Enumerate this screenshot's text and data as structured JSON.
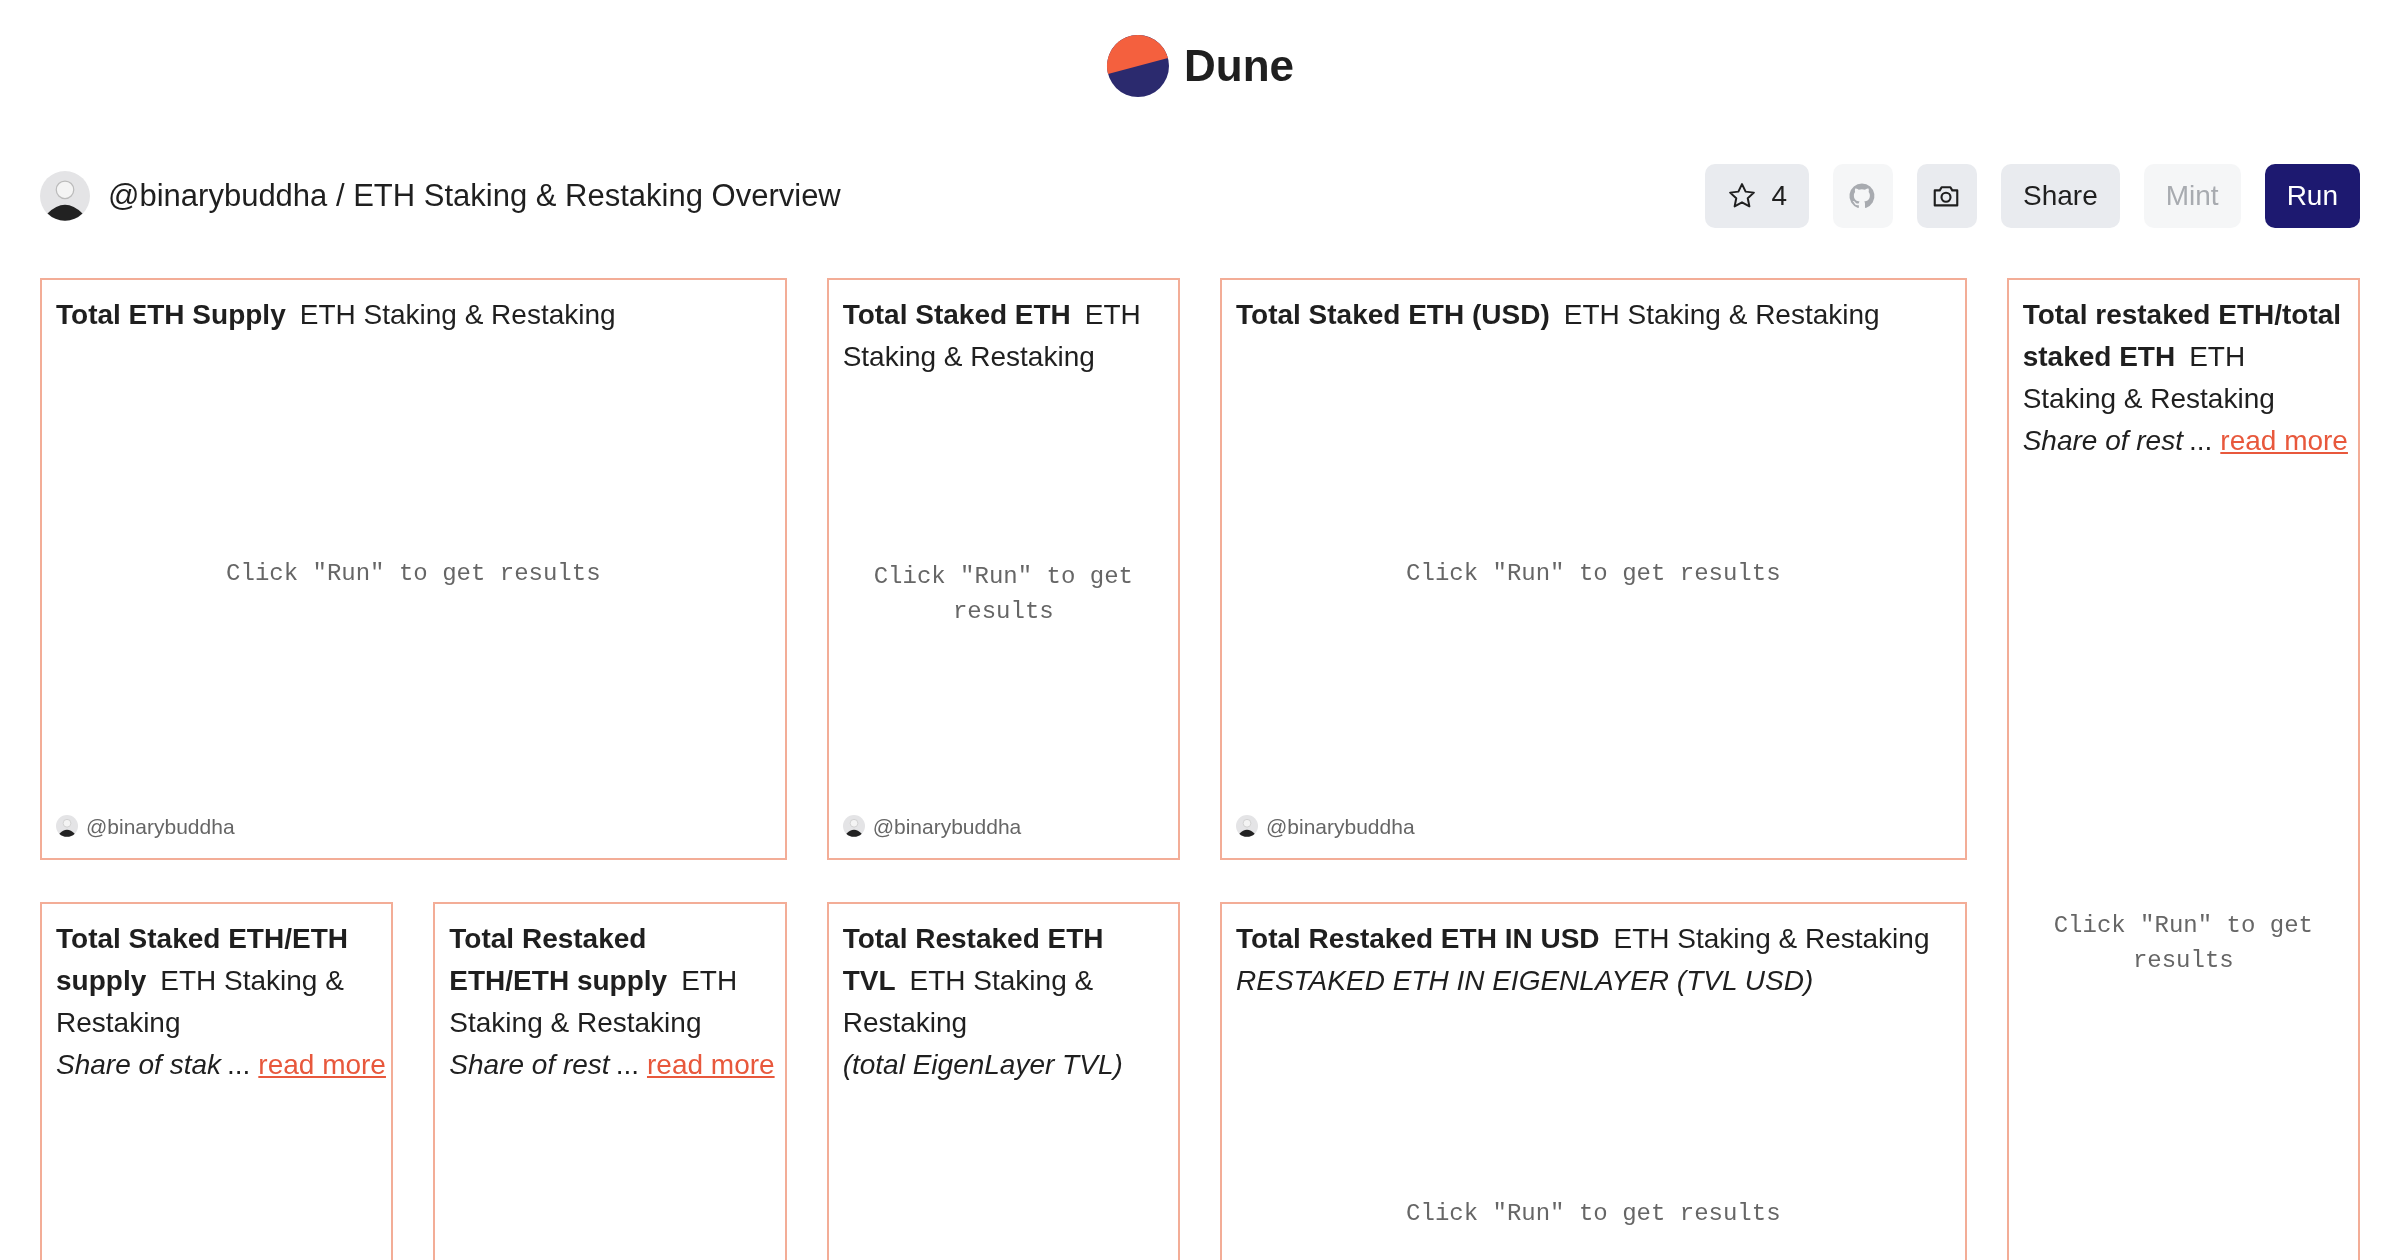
{
  "logo": {
    "text": "Dune"
  },
  "header": {
    "title": "@binarybuddha / ETH Staking & Restaking Overview"
  },
  "toolbar": [
    {
      "kind": "star",
      "label": "4",
      "disabled": false
    },
    {
      "kind": "github",
      "disabled": true
    },
    {
      "kind": "camera",
      "disabled": false
    },
    {
      "kind": "text",
      "label": "Share",
      "disabled": false
    },
    {
      "kind": "text",
      "label": "Mint",
      "disabled": true
    },
    {
      "kind": "primary",
      "label": "Run",
      "disabled": false
    }
  ],
  "cards": [
    {
      "kind": "wide",
      "title": "Total ETH Supply",
      "subtitle": "ETH Staking & Restaking",
      "placeholder": "Click \"Run\" to get results",
      "author": "@binarybuddha"
    },
    {
      "kind": "narrow",
      "title": "Total Staked ETH",
      "subtitle": "ETH Staking & Restaking",
      "placeholder": "Click \"Run\" to get results",
      "author": "@binarybuddha"
    },
    {
      "kind": "wide",
      "title": "Total Staked ETH (USD)",
      "subtitle": "ETH Staking & Restaking",
      "placeholder": "Click \"Run\" to get results",
      "author": "@binarybuddha"
    },
    {
      "kind": "tall",
      "title": "Total restaked ETH/total staked ETH",
      "subtitle": "ETH Staking & Restaking",
      "description": "Share of rest",
      "ellipsis": "...",
      "link": "read more",
      "placeholder": "Click \"Run\" to get results"
    },
    {
      "kind": "narrow",
      "title": "Total Staked ETH/ETH supply",
      "subtitle": "ETH Staking & Restaking",
      "description": "Share of stak",
      "ellipsis": "...",
      "link": "read more"
    },
    {
      "kind": "narrow",
      "title": "Total Restaked ETH/ETH supply",
      "subtitle": "ETH Staking & Restaking",
      "description": "Share of rest",
      "ellipsis": "...",
      "link": "read more"
    },
    {
      "kind": "narrow",
      "title": "Total Restaked ETH TVL",
      "subtitle": "ETH Staking & Restaking",
      "description": "(total EigenLayer TVL)"
    },
    {
      "kind": "wide",
      "title": "Total Restaked ETH IN USD",
      "subtitle": "ETH Staking & Restaking",
      "description": "RESTAKED ETH IN EIGENLAYER (TVL USD)",
      "placeholder": "Click \"Run\" to get results"
    }
  ]
}
